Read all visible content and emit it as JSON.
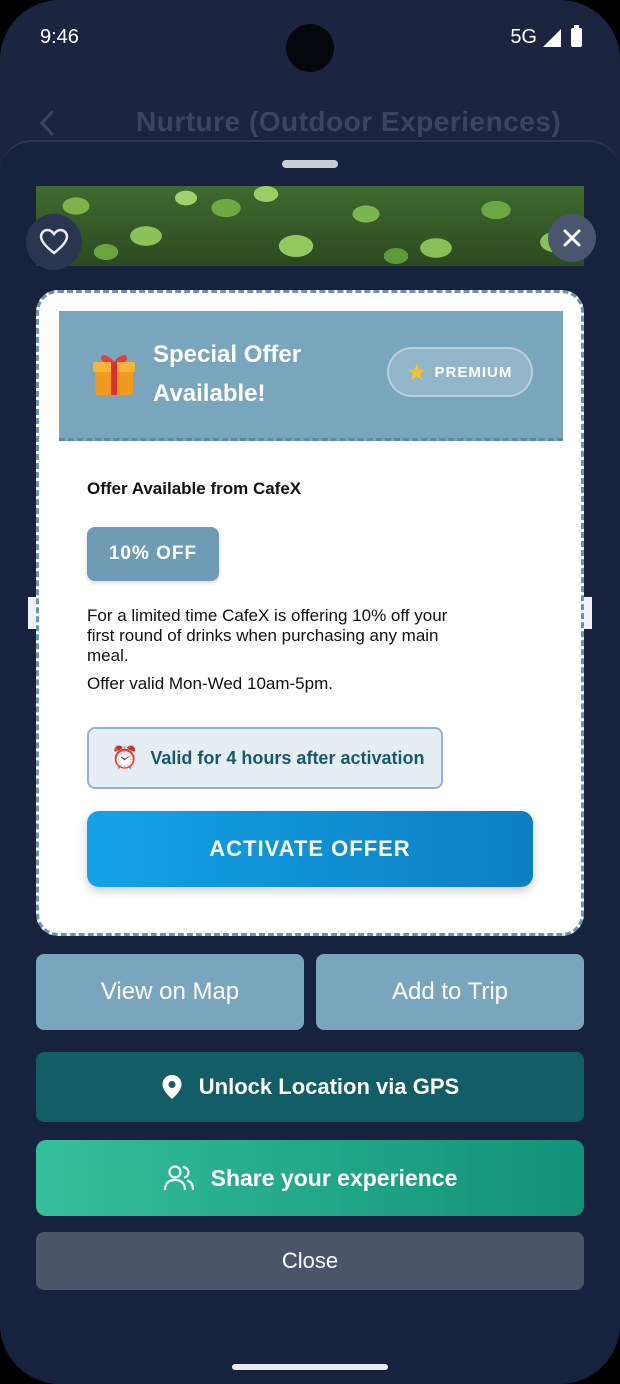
{
  "status_bar": {
    "time": "9:46",
    "network": "5G"
  },
  "header": {
    "title": "Nurture (Outdoor Experiences)"
  },
  "offer": {
    "title": "Special Offer Available!",
    "badge": "PREMIUM",
    "from": "Offer Available from CafeX",
    "discount": "10% OFF",
    "description": "For a limited time CafeX is offering 10% off your first round of drinks when purchasing any main meal.",
    "valid_days": "Offer valid Mon-Wed 10am-5pm.",
    "validity": "Valid for 4 hours after activation",
    "activate_label": "ACTIVATE OFFER"
  },
  "actions": {
    "view_map": "View on Map",
    "add_trip": "Add to Trip",
    "unlock_gps": "Unlock Location via GPS",
    "share": "Share your experience",
    "close": "Close"
  },
  "icons": [
    "back-icon",
    "heart-icon",
    "close-icon",
    "gift-icon",
    "star-icon",
    "alarm-clock-icon",
    "location-pin-icon",
    "users-icon"
  ],
  "colors": {
    "accent_blue": "#12a3e6",
    "teal": "#135e66",
    "share_green": "#34bf9b",
    "banner": "#7aa6bd"
  }
}
